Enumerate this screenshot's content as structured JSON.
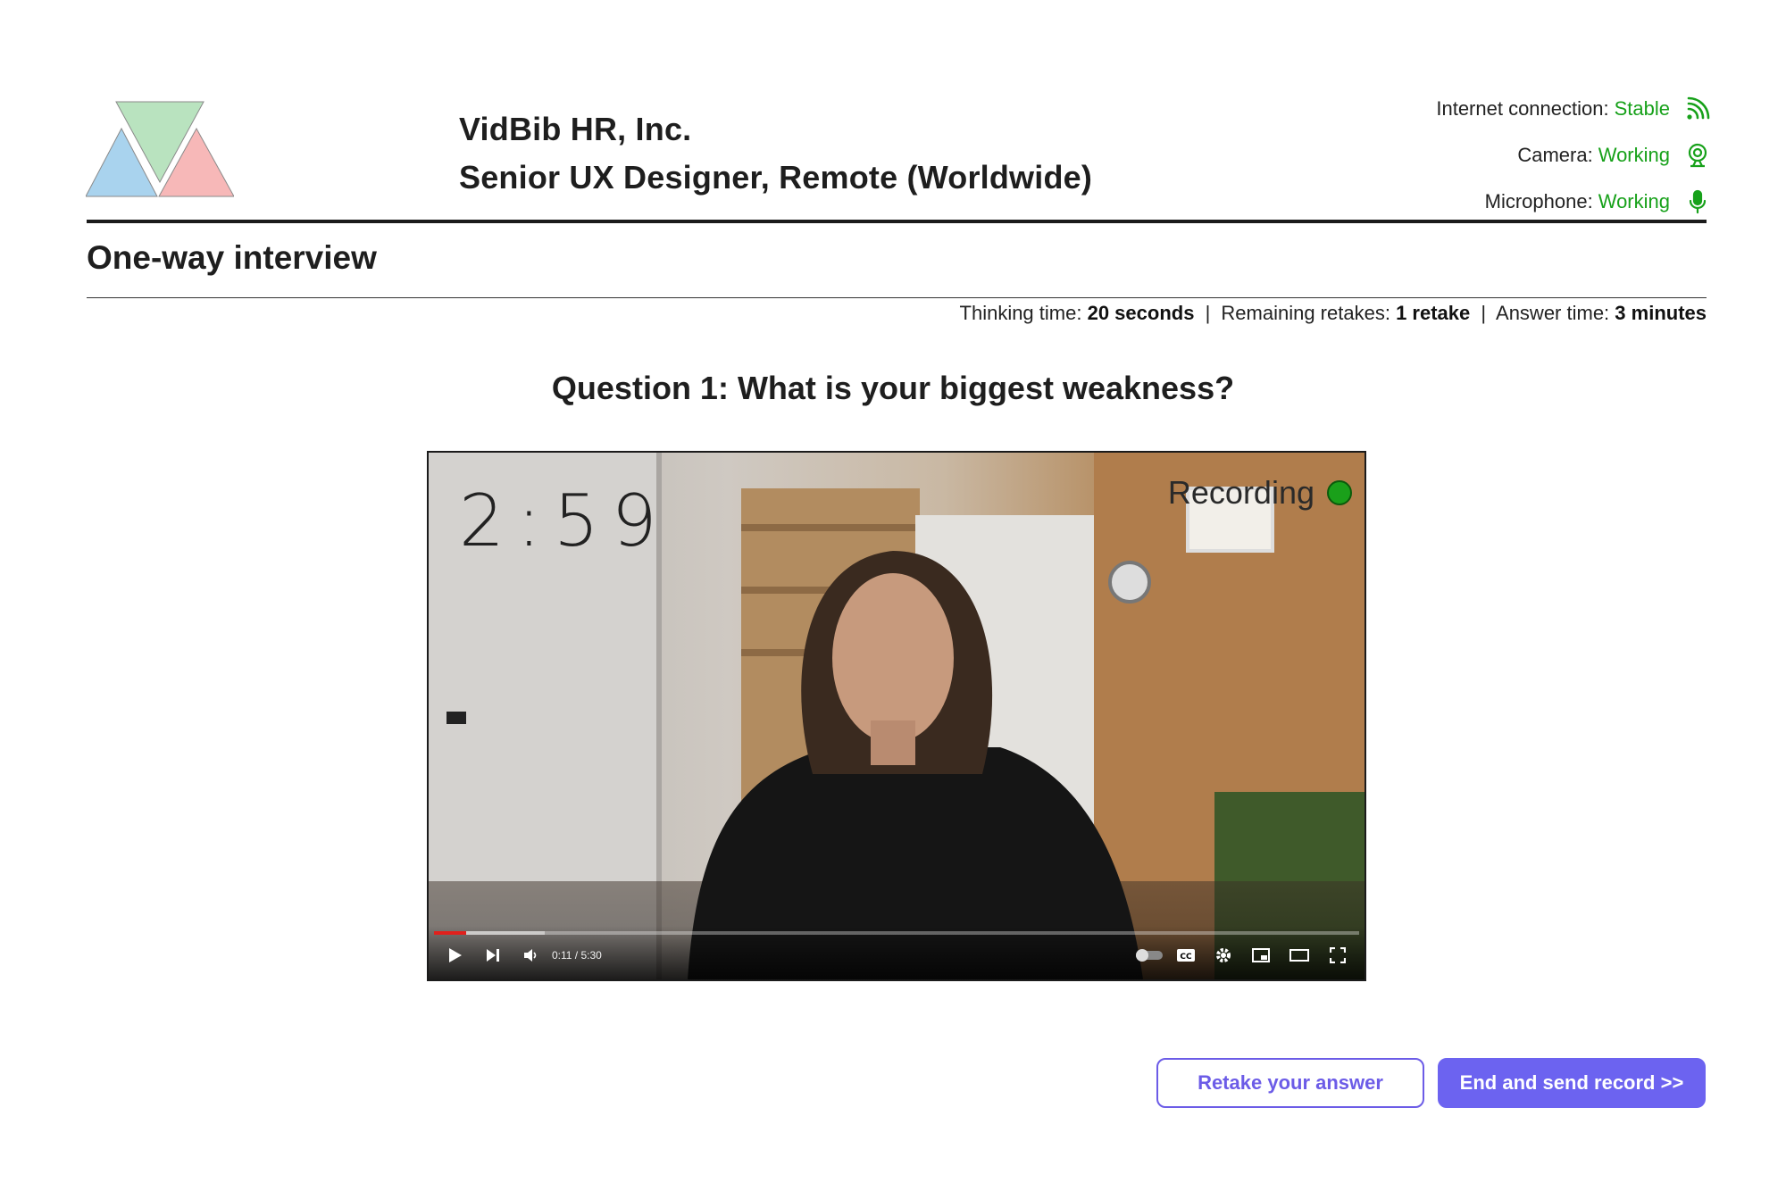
{
  "header": {
    "company": "VidBib HR, Inc.",
    "position": "Senior UX Designer, Remote (Worldwide)"
  },
  "status": {
    "internet": {
      "label": "Internet connection:",
      "value": "Stable",
      "icon": "wifi-signal-icon"
    },
    "camera": {
      "label": "Camera:",
      "value": "Working",
      "icon": "webcam-icon"
    },
    "microphone": {
      "label": "Microphone:",
      "value": "Working",
      "icon": "microphone-icon"
    },
    "ok_color": "#17a11a"
  },
  "section_title": "One-way interview",
  "meta": {
    "thinking_label": "Thinking time:",
    "thinking_value": "20 seconds",
    "retakes_label": "Remaining retakes:",
    "retakes_value": "1 retake",
    "answer_label": "Answer time:",
    "answer_value": "3 minutes",
    "separator": "|"
  },
  "question": "Question 1: What is your biggest weakness?",
  "video": {
    "timer": "2:59",
    "recording_label": "Recording",
    "recording_color": "#1aa01a",
    "time_display": "0:11 / 5:30",
    "progress_fraction": 0.035
  },
  "actions": {
    "retake": "Retake your answer",
    "end": "End and send record >>",
    "accent": "#6c63f0"
  }
}
